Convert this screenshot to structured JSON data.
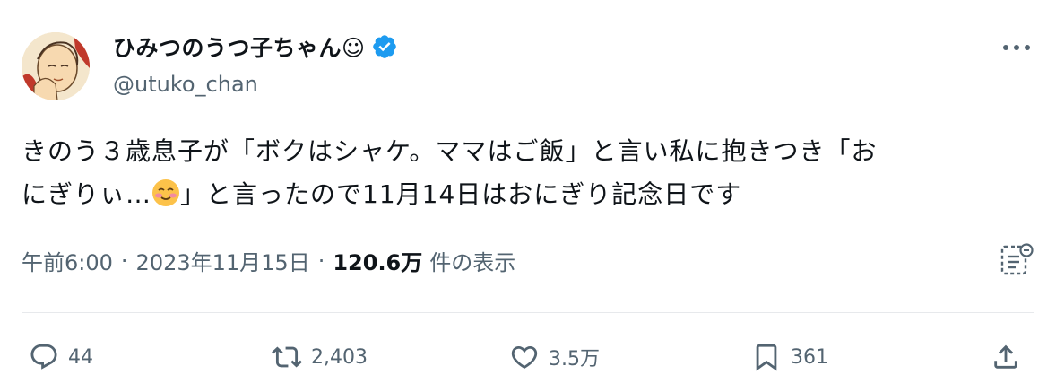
{
  "user": {
    "display_name": "ひみつのうつ子ちゃん☺",
    "handle": "@utuko_chan"
  },
  "tweet": {
    "line1": "きのう３歳息子が「ボクはシャケ。ママはご飯」と言い私に抱きつき「お",
    "line2_pre": "にぎりぃ…",
    "line2_post": "」と言ったので11月14日はおにぎり記念日です"
  },
  "meta": {
    "time": "午前6:00",
    "sep1": "·",
    "date": "2023年11月15日",
    "sep2": "·",
    "views": "120.6万",
    "views_label": "件の表示"
  },
  "actions": {
    "replies": "44",
    "retweets": "2,403",
    "likes": "3.5万",
    "bookmarks": "361"
  },
  "colors": {
    "verified": "#1d9bf0",
    "secondary": "#536471",
    "text": "#0f1419"
  }
}
